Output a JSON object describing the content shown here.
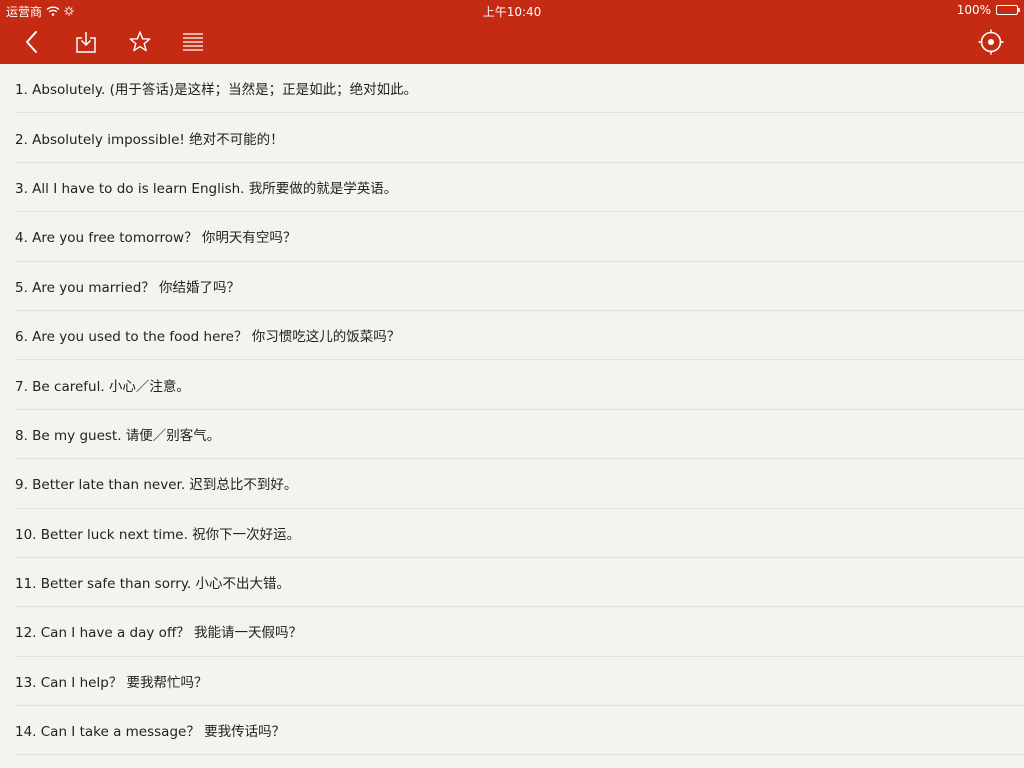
{
  "status_bar": {
    "carrier": "运营商",
    "time": "上午10:40",
    "battery": "100%"
  },
  "toolbar": {
    "buttons": [
      {
        "icon": "chevron-left-icon"
      },
      {
        "icon": "download-icon"
      },
      {
        "icon": "star-icon"
      },
      {
        "icon": "list-icon"
      },
      {
        "icon": "target-icon"
      }
    ]
  },
  "theme": {
    "accent": "#c42b12",
    "background": "#f3f3ef",
    "divider": "#e2e2dd"
  },
  "phrases": [
    "1. Absolutely. (用于答话)是这样；当然是；正是如此；绝对如此。",
    "2. Absolutely impossible! 绝对不可能的！",
    "3. All I have to do is learn English. 我所要做的就是学英语。",
    "4. Are you free tomorrow？ 你明天有空吗？",
    "5. Are you married？ 你结婚了吗？",
    "6. Are you used to the food here？ 你习惯吃这儿的饭菜吗？",
    "7. Be careful. 小心／注意。",
    "8. Be my guest. 请便／别客气。",
    "9. Better late than never. 迟到总比不到好。",
    "10. Better luck next time. 祝你下一次好运。",
    "11. Better safe than sorry. 小心不出大错。",
    "12. Can I have a day off？ 我能请一天假吗？",
    "13. Can I help？ 要我帮忙吗？",
    "14. Can I take a message？ 要我传话吗？"
  ]
}
